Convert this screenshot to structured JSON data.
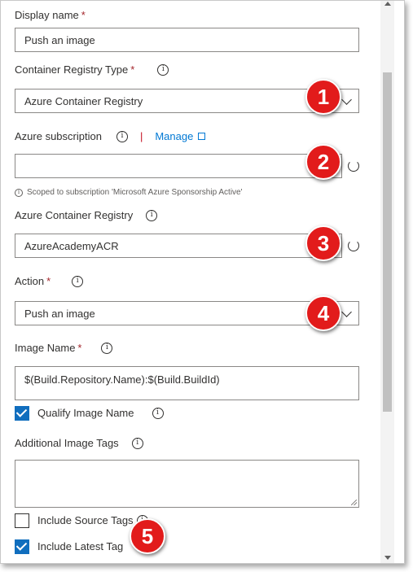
{
  "form": {
    "display_name": {
      "label": "Display name",
      "required": "*",
      "value": "Push an image"
    },
    "registry_type": {
      "label": "Container Registry Type",
      "required": "*",
      "value": "Azure Container Registry"
    },
    "subscription": {
      "label": "Azure subscription",
      "separator": "|",
      "manage_label": "Manage",
      "value": "",
      "hint": "Scoped to subscription 'Microsoft Azure Sponsorship Active'"
    },
    "registry": {
      "label": "Azure Container Registry",
      "value": "AzureAcademyACR"
    },
    "action": {
      "label": "Action",
      "required": "*",
      "value": "Push an image"
    },
    "image_name": {
      "label": "Image Name",
      "required": "*",
      "value": "$(Build.Repository.Name):$(Build.BuildId)"
    },
    "qualify_image_name": {
      "label": "Qualify Image Name",
      "checked": true
    },
    "additional_tags": {
      "label": "Additional Image Tags",
      "value": ""
    },
    "include_source_tags": {
      "label": "Include Source Tags",
      "checked": false
    },
    "include_latest_tag": {
      "label": "Include Latest Tag",
      "checked": true
    }
  },
  "info_glyph": "i",
  "badges": [
    "1",
    "2",
    "3",
    "4",
    "5"
  ],
  "colors": {
    "accent": "#106ebe",
    "link": "#0078d4",
    "required": "#a4262c",
    "badge": "#e21b1b"
  },
  "icons": [
    "info-icon",
    "chevron-down-icon",
    "refresh-icon",
    "external-link-icon",
    "checkmark-icon"
  ]
}
